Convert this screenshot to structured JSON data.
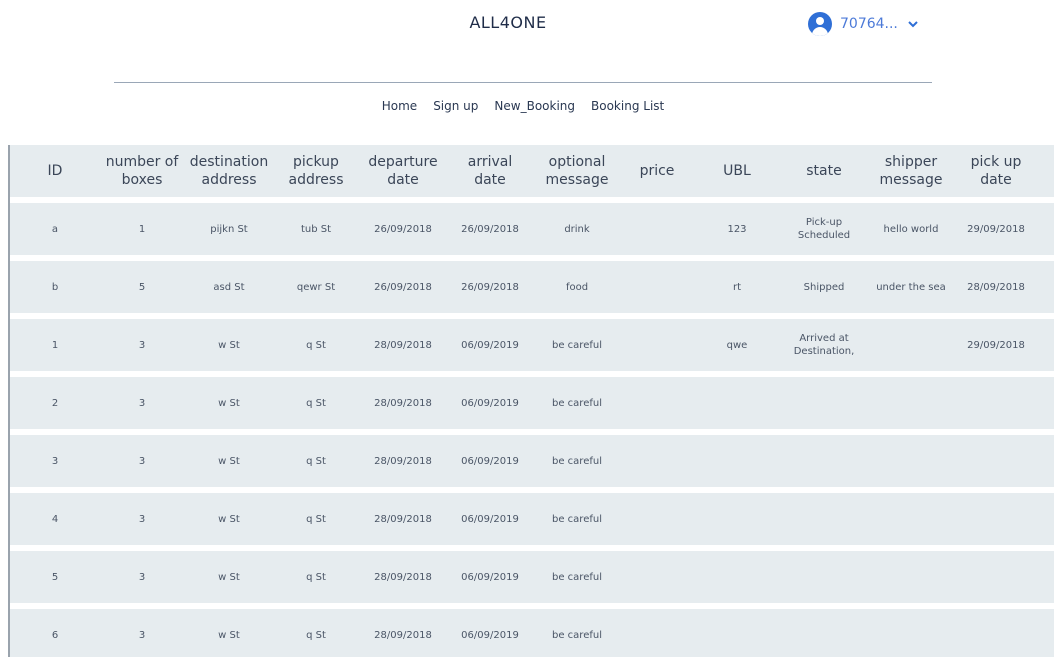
{
  "header": {
    "site_title": "ALL4ONE",
    "user_name": "70764...",
    "avatar_icon": "user-avatar-icon",
    "dropdown_icon": "chevron-down-icon",
    "accent_color": "#2f6fd6"
  },
  "nav": {
    "items": [
      {
        "label": "Home"
      },
      {
        "label": "Sign up"
      },
      {
        "label": "New_Booking"
      },
      {
        "label": "Booking List"
      }
    ]
  },
  "table": {
    "columns": [
      "ID",
      "number of boxes",
      "destination address",
      "pickup address",
      "departure date",
      "arrival date",
      "optional message",
      "price",
      "UBL",
      "state",
      "shipper message",
      "pick up date"
    ],
    "rows": [
      {
        "id": "a",
        "boxes": "1",
        "destination": "pijkn St",
        "pickup": "tub St",
        "departure": "26/09/2018",
        "arrival": "26/09/2018",
        "message": "drink",
        "price": "",
        "ubl": "123",
        "state": "Pick-up Scheduled",
        "shipper_message": "hello world",
        "pickup_date": "29/09/2018"
      },
      {
        "id": "b",
        "boxes": "5",
        "destination": "asd St",
        "pickup": "qewr St",
        "departure": "26/09/2018",
        "arrival": "26/09/2018",
        "message": "food",
        "price": "",
        "ubl": "rt",
        "state": "Shipped",
        "shipper_message": "under the sea",
        "pickup_date": "28/09/2018"
      },
      {
        "id": "1",
        "boxes": "3",
        "destination": "w St",
        "pickup": "q St",
        "departure": "28/09/2018",
        "arrival": "06/09/2019",
        "message": "be careful",
        "price": "",
        "ubl": "qwe",
        "state": "Arrived at Destination,",
        "shipper_message": "",
        "pickup_date": "29/09/2018"
      },
      {
        "id": "2",
        "boxes": "3",
        "destination": "w St",
        "pickup": "q St",
        "departure": "28/09/2018",
        "arrival": "06/09/2019",
        "message": "be careful",
        "price": "",
        "ubl": "",
        "state": "",
        "shipper_message": "",
        "pickup_date": ""
      },
      {
        "id": "3",
        "boxes": "3",
        "destination": "w St",
        "pickup": "q St",
        "departure": "28/09/2018",
        "arrival": "06/09/2019",
        "message": "be careful",
        "price": "",
        "ubl": "",
        "state": "",
        "shipper_message": "",
        "pickup_date": ""
      },
      {
        "id": "4",
        "boxes": "3",
        "destination": "w St",
        "pickup": "q St",
        "departure": "28/09/2018",
        "arrival": "06/09/2019",
        "message": "be careful",
        "price": "",
        "ubl": "",
        "state": "",
        "shipper_message": "",
        "pickup_date": ""
      },
      {
        "id": "5",
        "boxes": "3",
        "destination": "w St",
        "pickup": "q St",
        "departure": "28/09/2018",
        "arrival": "06/09/2019",
        "message": "be careful",
        "price": "",
        "ubl": "",
        "state": "",
        "shipper_message": "",
        "pickup_date": ""
      },
      {
        "id": "6",
        "boxes": "3",
        "destination": "w St",
        "pickup": "q St",
        "departure": "28/09/2018",
        "arrival": "06/09/2019",
        "message": "be careful",
        "price": "",
        "ubl": "",
        "state": "",
        "shipper_message": "",
        "pickup_date": ""
      }
    ]
  }
}
